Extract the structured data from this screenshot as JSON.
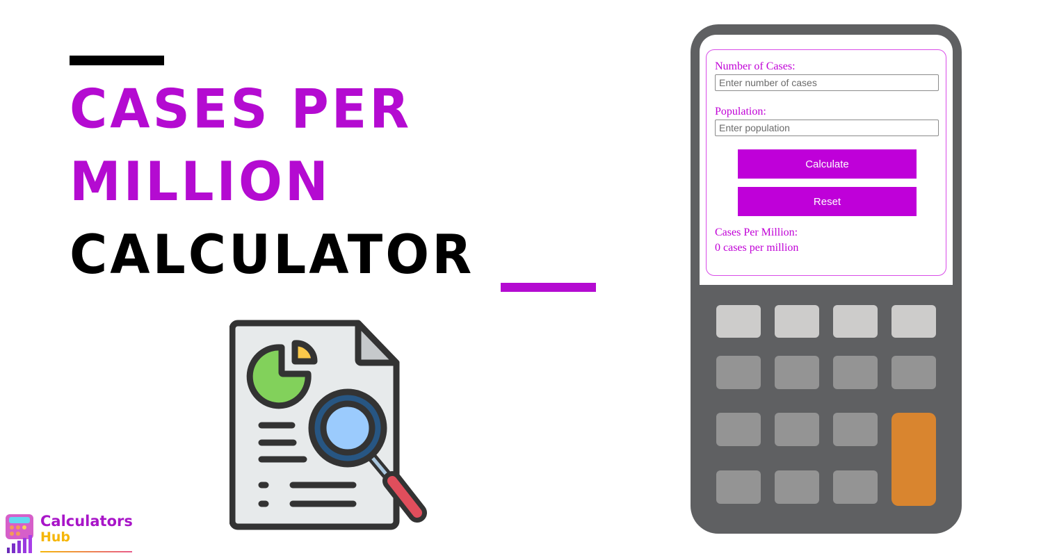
{
  "hero": {
    "title_line1": "CASES PER",
    "title_line2": "MILLION",
    "title_line3": "CALCULATOR",
    "accent_color": "#b40bd1",
    "dark_color": "#000000"
  },
  "form": {
    "cases_label": "Number of Cases:",
    "cases_placeholder": "Enter number of cases",
    "cases_value": "",
    "population_label": "Population:",
    "population_placeholder": "Enter population",
    "population_value": "",
    "calculate_label": "Calculate",
    "reset_label": "Reset",
    "result_label": "Cases Per Million:",
    "result_value": "0 cases per million",
    "button_color": "#bf00d9",
    "text_color": "#c000d6"
  },
  "calculator_graphic": {
    "body_color": "#5f6062",
    "key_rows": [
      [
        "light",
        "light",
        "light",
        "light"
      ],
      [
        "gray",
        "gray",
        "gray",
        "gray"
      ],
      [
        "gray",
        "gray",
        "gray",
        "orange"
      ],
      [
        "gray",
        "gray",
        "gray"
      ]
    ],
    "accent_key_color": "#d9852f"
  },
  "illustration": {
    "icon": "document-pie-chart-magnifier-icon"
  },
  "logo": {
    "line1": "Calculators",
    "line2": "Hub"
  }
}
